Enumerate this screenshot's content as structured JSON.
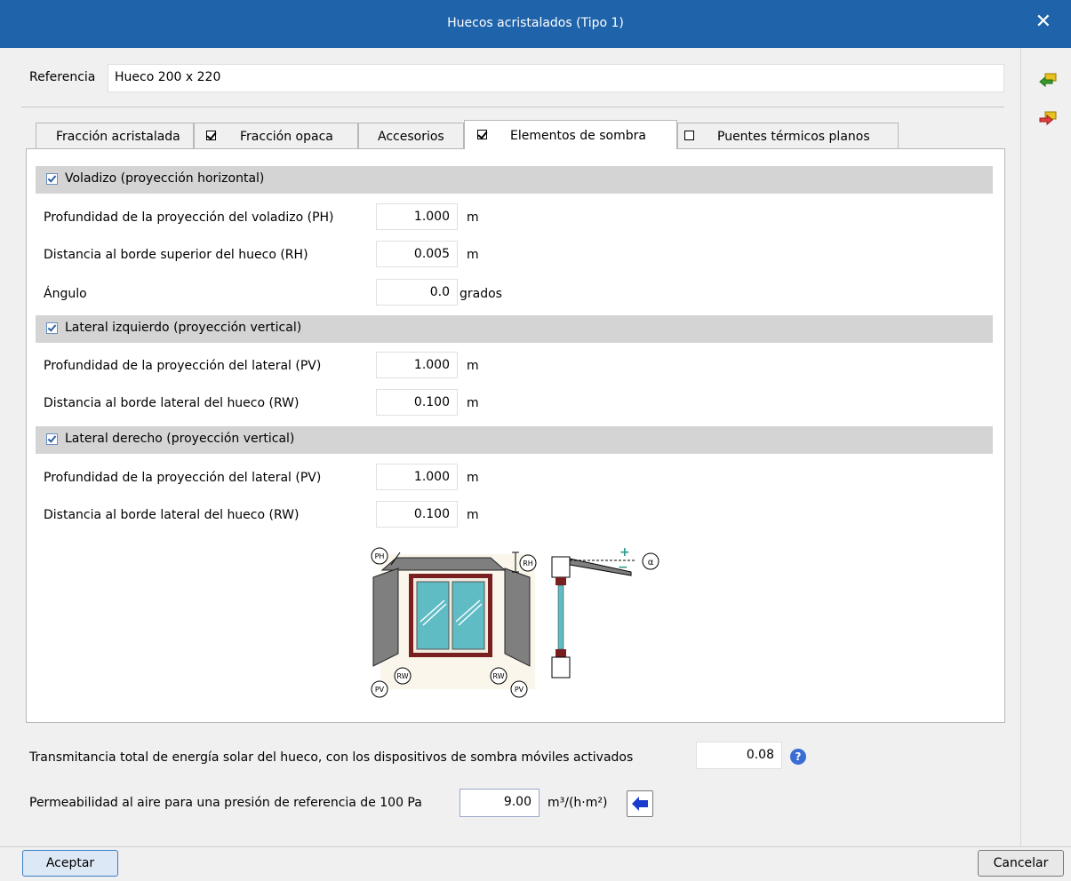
{
  "window": {
    "title": "Huecos acristalados (Tipo 1)",
    "close_glyph": "✕"
  },
  "reference": {
    "label": "Referencia",
    "value": "Hueco 200 x 220"
  },
  "side_icons": [
    "import-arrow-icon",
    "export-arrow-icon"
  ],
  "tabs": [
    {
      "label": "Fracción acristalada",
      "has_checkbox": false,
      "checked": false,
      "active": false
    },
    {
      "label": "Fracción opaca",
      "has_checkbox": true,
      "checked": true,
      "active": false
    },
    {
      "label": "Accesorios",
      "has_checkbox": false,
      "checked": false,
      "active": false
    },
    {
      "label": "Elementos de sombra",
      "has_checkbox": true,
      "checked": true,
      "active": true
    },
    {
      "label": "Puentes térmicos planos",
      "has_checkbox": true,
      "checked": false,
      "active": false
    }
  ],
  "voladizo": {
    "title": "Voladizo (proyección horizontal)",
    "checked": true,
    "fields": [
      {
        "label": "Profundidad de la proyección del voladizo (PH)",
        "value": "1.000",
        "unit": "m"
      },
      {
        "label": "Distancia al borde superior del hueco (RH)",
        "value": "0.005",
        "unit": "m"
      },
      {
        "label": "Ángulo",
        "value": "0.0",
        "unit": "grados"
      }
    ]
  },
  "lateral_izquierdo": {
    "title": "Lateral izquierdo (proyección vertical)",
    "checked": true,
    "fields": [
      {
        "label": "Profundidad de la proyección del lateral (PV)",
        "value": "1.000",
        "unit": "m"
      },
      {
        "label": "Distancia al borde lateral del hueco (RW)",
        "value": "0.100",
        "unit": "m"
      }
    ]
  },
  "lateral_derecho": {
    "title": "Lateral derecho (proyección vertical)",
    "checked": true,
    "fields": [
      {
        "label": "Profundidad de la proyección del lateral (PV)",
        "value": "1.000",
        "unit": "m"
      },
      {
        "label": "Distancia al borde lateral del hueco (RW)",
        "value": "0.100",
        "unit": "m"
      }
    ]
  },
  "diagram": {
    "ph": "PH",
    "rh": "RH",
    "pv": "PV",
    "rw": "RW",
    "alpha": "α",
    "plus": "+",
    "minus": "−"
  },
  "transmitancia": {
    "label": "Transmitancia total de energía solar del hueco, con los dispositivos de sombra móviles activados",
    "value": "0.08",
    "help": "?"
  },
  "permeabilidad": {
    "label": "Permeabilidad al aire para una presión de referencia de 100 Pa",
    "value": "9.00",
    "unit": "m³/(h·m²)"
  },
  "buttons": {
    "accept": "Aceptar",
    "cancel": "Cancelar"
  },
  "colors": {
    "titlebar": "#1f63aa",
    "glass": "#5fbcc4",
    "frame": "#7a1f1f",
    "shade": "#7f7f7f",
    "help": "#3a6dd4",
    "arrow": "#1a3ccc"
  }
}
